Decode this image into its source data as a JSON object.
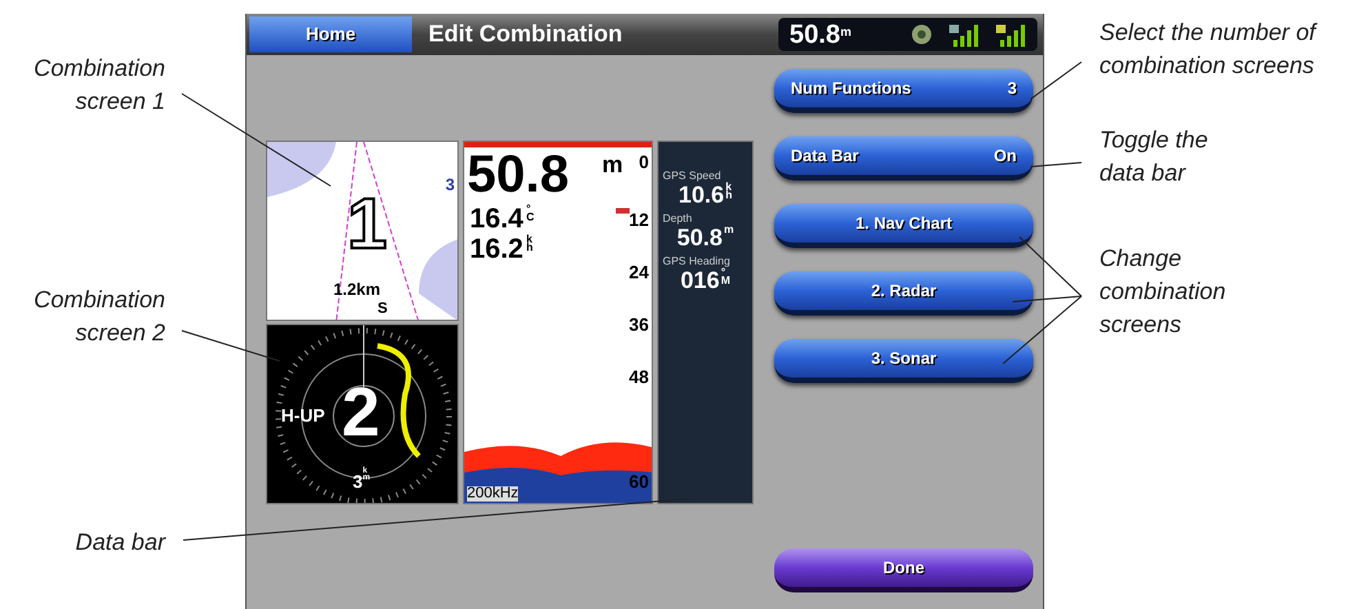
{
  "callouts_left": [
    {
      "text": "Combination screen 1"
    },
    {
      "text": "Combination screen 2"
    },
    {
      "text": "Data bar"
    }
  ],
  "callouts_right": [
    {
      "text": "Select the number of combination screens"
    },
    {
      "text": "Toggle the data bar"
    },
    {
      "text": "Change combination screens"
    }
  ],
  "screen": {
    "home_button": "Home",
    "title": "Edit Combination",
    "status": {
      "depth": "50.8",
      "unit": "m"
    },
    "nav_chart": {
      "number": "1",
      "marker": "3",
      "scale": "1.2km",
      "compass": "S"
    },
    "radar": {
      "number": "2",
      "mode": "H-UP",
      "range": "3",
      "range_unit": [
        "k",
        "m"
      ]
    },
    "sonar": {
      "depth": "50.8",
      "depth_unit": "m",
      "temperature": "16.4",
      "temperature_unit": [
        "°",
        "C"
      ],
      "speed": "16.2",
      "speed_unit": [
        "k",
        "h"
      ],
      "frequency": "200kHz",
      "scale": [
        "0",
        "12",
        "24",
        "36",
        "48",
        "60"
      ]
    },
    "data_bar": [
      {
        "label": "GPS Speed",
        "value": "10.6",
        "unit": [
          "k",
          "h"
        ]
      },
      {
        "label": "Depth",
        "value": "50.8",
        "unit": [
          "m"
        ]
      },
      {
        "label": "GPS Heading",
        "value": "016",
        "unit": [
          "°",
          "M"
        ]
      }
    ],
    "menu": [
      {
        "kind": "setting",
        "label": "Num Functions",
        "value": "3"
      },
      {
        "kind": "setting",
        "label": "Data Bar",
        "value": "On"
      },
      {
        "kind": "screen",
        "label": "1. Nav Chart"
      },
      {
        "kind": "screen",
        "label": "2. Radar"
      },
      {
        "kind": "screen",
        "label": "3. Sonar"
      }
    ],
    "done_button": "Done"
  }
}
